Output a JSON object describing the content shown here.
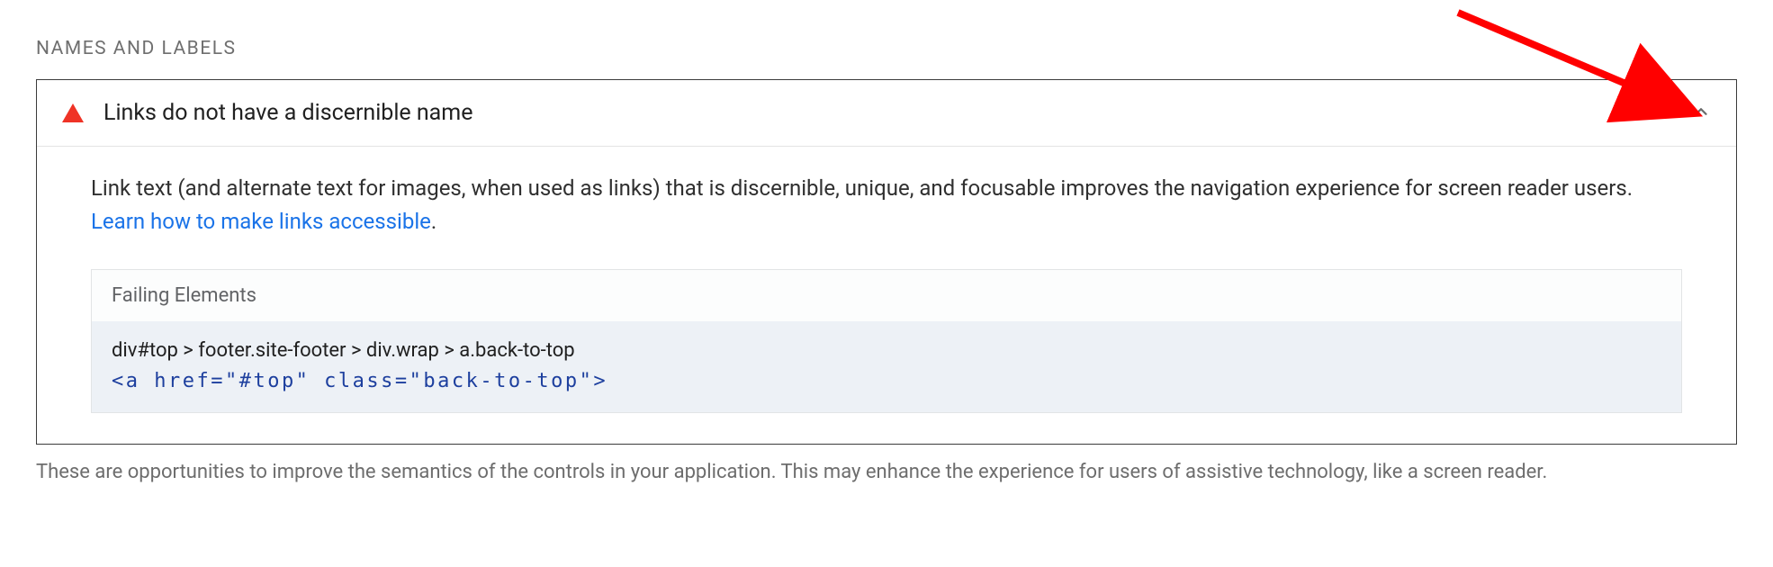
{
  "section": {
    "heading": "NAMES AND LABELS"
  },
  "audit": {
    "title": "Links do not have a discernible name",
    "description_pre": "Link text (and alternate text for images, when used as links) that is discernible, unique, and focusable improves the navigation experience for screen reader users. ",
    "learn_more": "Learn how to make links accessible",
    "period": ".",
    "failing_label": "Failing Elements",
    "selector_path": "div#top > footer.site-footer > div.wrap > a.back-to-top",
    "snippet": "<a href=\"#top\" class=\"back-to-top\">"
  },
  "footnote": "These are opportunities to improve the semantics of the controls in your application. This may enhance the experience for users of assistive technology, like a screen reader."
}
